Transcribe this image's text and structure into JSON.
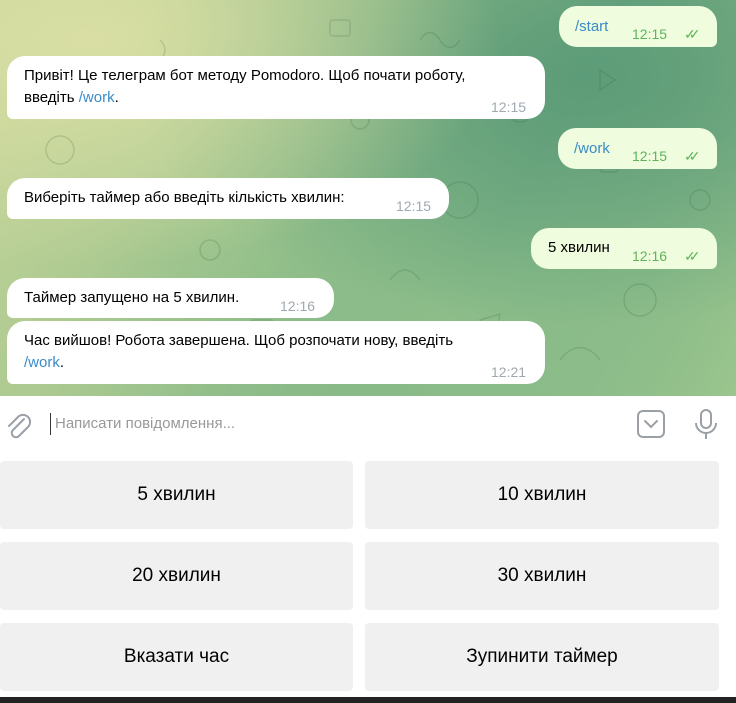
{
  "messages": [
    {
      "dir": "out",
      "text": "/start",
      "time": "12:15",
      "is_command": true
    },
    {
      "dir": "in",
      "line1": "Привіт! Це телеграм бот методу Pomodoro. Щоб почати роботу,",
      "line2_prefix": "введіть ",
      "line2_link": "/work",
      "line2_suffix": ".",
      "time": "12:15"
    },
    {
      "dir": "out",
      "text": "/work",
      "time": "12:15",
      "is_command": true
    },
    {
      "dir": "in",
      "text": "Виберіть таймер або введіть кількість хвилин:",
      "time": "12:15"
    },
    {
      "dir": "out",
      "text": "5 хвилин",
      "time": "12:16",
      "is_command": false
    },
    {
      "dir": "in",
      "text": "Таймер запущено на 5 хвилин.",
      "time": "12:16"
    },
    {
      "dir": "in",
      "line1": "Час вийшов! Робота завершена. Щоб розпочати нову, введіть",
      "line2_link": "/work",
      "line2_suffix": ".",
      "time": "12:21"
    }
  ],
  "ticks": "✓✓",
  "composer": {
    "placeholder": "Написати повідомлення..."
  },
  "icons": {
    "attach": "paperclip-icon",
    "sticker": "sticker-icon",
    "mic": "microphone-icon"
  },
  "keyboard": [
    [
      "5 хвилин",
      "10 хвилин"
    ],
    [
      "20 хвилин",
      "30 хвилин"
    ],
    [
      "Вказати час",
      "Зупинити таймер"
    ]
  ],
  "colors": {
    "incoming": "#ffffff",
    "outgoing": "#effdde",
    "link": "#3a8bc8",
    "tick": "#5fb45a",
    "button": "#f0f0f0"
  }
}
